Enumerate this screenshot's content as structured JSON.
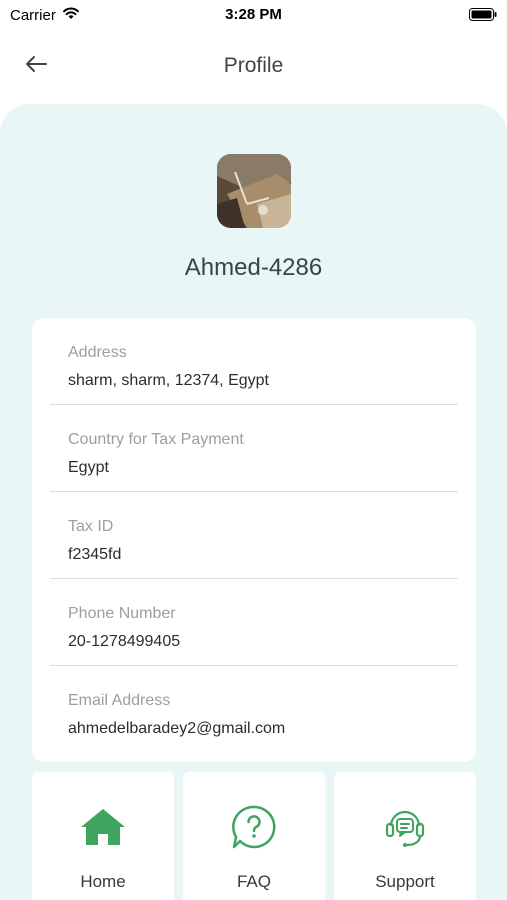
{
  "status_bar": {
    "carrier": "Carrier",
    "time": "3:28 PM",
    "wifi_icon": "wifi-icon",
    "battery_icon": "battery-icon"
  },
  "nav": {
    "title": "Profile",
    "back_icon": "arrow-left-icon"
  },
  "profile": {
    "name": "Ahmed-4286",
    "avatar_icon": "profile-photo"
  },
  "info": {
    "address": {
      "label": "Address",
      "value": "sharm, sharm, 12374, Egypt"
    },
    "tax_country": {
      "label": "Country for Tax Payment",
      "value": "Egypt"
    },
    "tax_id": {
      "label": "Tax ID",
      "value": "f2345fd"
    },
    "phone": {
      "label": "Phone Number",
      "value": "20-1278499405"
    },
    "email": {
      "label": "Email Address",
      "value": "ahmedelbaradey2@gmail.com"
    }
  },
  "tabs": [
    {
      "label": "Home",
      "icon": "home-icon"
    },
    {
      "label": "FAQ",
      "icon": "question-bubble-icon"
    },
    {
      "label": "Support",
      "icon": "headset-icon"
    }
  ],
  "colors": {
    "accent_green": "#3fa45d",
    "panel_background": "#e9f6f6",
    "card_background": "#ffffff"
  }
}
